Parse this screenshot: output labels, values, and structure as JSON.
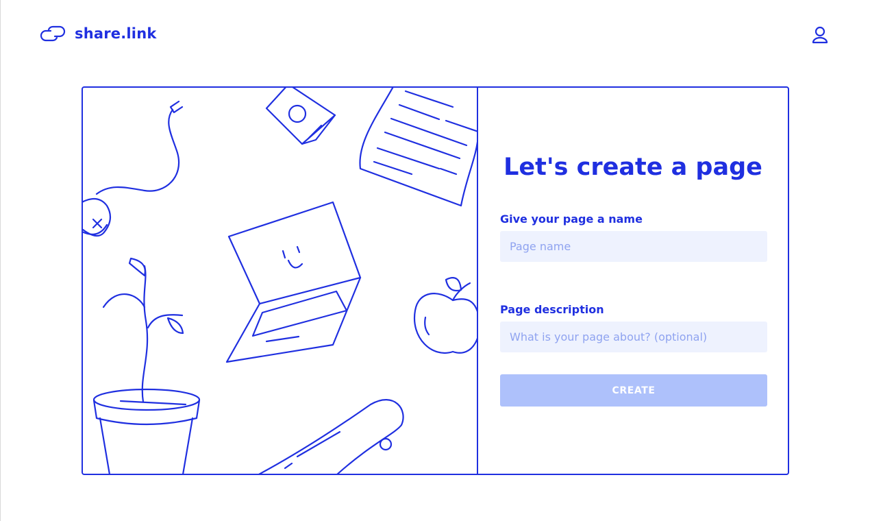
{
  "header": {
    "brand_name": "share.link",
    "logo_icon": "chain-link-icon",
    "account_icon": "user-icon"
  },
  "illustration": {
    "items": [
      "mouse-icon",
      "camera-icon",
      "document-icon",
      "laptop-icon",
      "apple-icon",
      "plant-icon",
      "skateboard-icon"
    ]
  },
  "form": {
    "title": "Let's create a page",
    "name_label": "Give your page a name",
    "name_placeholder": "Page name",
    "name_value": "",
    "description_label": "Page description",
    "description_placeholder": "What is your page about? (optional)",
    "description_value": "",
    "create_label": "CREATE"
  },
  "colors": {
    "accent": "#1f2fe0",
    "input_background": "#eef2fe",
    "button_disabled": "#aec1fb",
    "placeholder": "#8fa3f0"
  }
}
